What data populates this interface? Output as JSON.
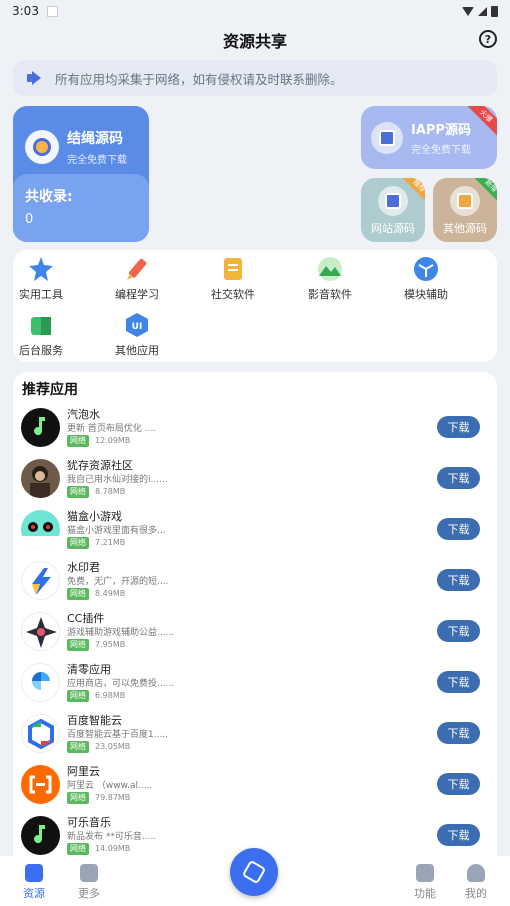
{
  "status_bar": {
    "time": "3:03"
  },
  "header": {
    "title": "资源共享",
    "help_symbol": "?"
  },
  "notice": {
    "text": "所有应用均采集于网络，如有侵权请及时联系删除。"
  },
  "main_card": {
    "name": "结绳源码",
    "subtitle": "完全免费下载",
    "count_label": "共收录:",
    "count_value": "0"
  },
  "iapp_card": {
    "name": "IAPP源码",
    "subtitle": "完全免费下载",
    "ribbon": "火爆"
  },
  "small_cards": [
    {
      "name": "网站源码",
      "ribbon": "推荐",
      "color": "#aecbcf",
      "ribbon_color": "#f0a641"
    },
    {
      "name": "其他源码",
      "ribbon": "新增",
      "color": "#cbb49a",
      "ribbon_color": "#3cae54"
    }
  ],
  "categories": [
    {
      "label": "实用工具",
      "icon": "star-icon"
    },
    {
      "label": "编程学习",
      "icon": "pen-icon"
    },
    {
      "label": "社交软件",
      "icon": "document-icon"
    },
    {
      "label": "影音软件",
      "icon": "mountain-icon"
    },
    {
      "label": "模块辅助",
      "icon": "cube-icon"
    },
    {
      "label": "后台服务",
      "icon": "server-icon"
    },
    {
      "label": "其他应用",
      "icon": "ui-icon"
    }
  ],
  "recommended": {
    "title": "推荐应用",
    "download_label": "下载",
    "tag_label": "网络",
    "apps": [
      {
        "name": "汽泡水",
        "desc": "更新 首页布局优化 ....",
        "size": "12.09MB"
      },
      {
        "name": "犹存资源社区",
        "desc": "我自己用水仙对接的i......",
        "size": "8.78MB"
      },
      {
        "name": "猫盒小游戏",
        "desc": "猫盒小游戏里面有很多...",
        "size": "7.21MB"
      },
      {
        "name": "水印君",
        "desc": "免费，无广，开源的短....",
        "size": "8.49MB"
      },
      {
        "name": "CC插件",
        "desc": "游戏辅助游戏辅助公益......",
        "size": "7.95MB"
      },
      {
        "name": "清零应用",
        "desc": "应用商店，可以免费投......",
        "size": "6.98MB"
      },
      {
        "name": "百度智能云",
        "desc": "百度智能云基于百度1.....",
        "size": "23.05MB"
      },
      {
        "name": "阿里云",
        "desc": "阿里云 （www.al.....",
        "size": "79.87MB"
      },
      {
        "name": "可乐音乐",
        "desc": "新品发布 **可乐音.....",
        "size": "14.09MB"
      }
    ]
  },
  "bottom_nav": [
    {
      "label": "资源",
      "active": true
    },
    {
      "label": "更多",
      "active": false
    },
    {
      "label": "功能",
      "active": false
    },
    {
      "label": "我的",
      "active": false
    }
  ]
}
